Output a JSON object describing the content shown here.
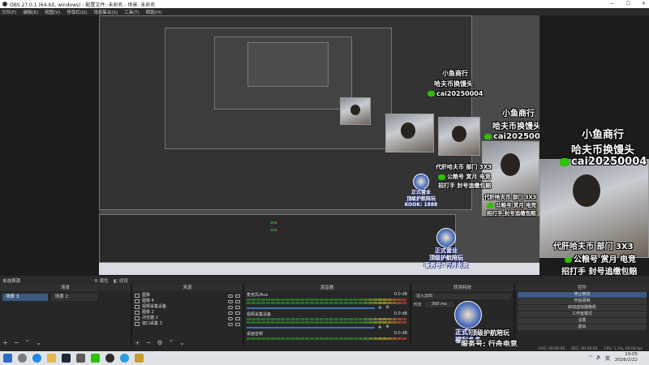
{
  "window": {
    "title": "OBS 27.0.1 (64-bit, windows) - 配置文件: 未命名 - 场景: 未命名",
    "controls": [
      "—",
      "☐",
      "✕"
    ]
  },
  "menu": [
    "文件(F)",
    "编辑(E)",
    "视图(V)",
    "停靠栏(D)",
    "场景集合(S)",
    "工具(T)",
    "帮助(H)"
  ],
  "overlay": {
    "line1": "小鱼商行",
    "line2": "哈夫币换馒头",
    "wechat_id": "cai20250004",
    "promo1": "代肝哈夫币 部门 3X3",
    "promo2": "公粮号 赏月 电竞",
    "promo3": "招打手 封号追缴包赔",
    "badge1": "正式营业",
    "badge2": "福利多多",
    "badge3": "顶级护航陪玩",
    "badge4": "服务号: 行舟电竞",
    "badge5": "KOOK: 1888"
  },
  "scene_bar": {
    "label": "未选择源",
    "properties": "属性",
    "filters": "滤镜"
  },
  "docks": {
    "scenes": {
      "title": "场景",
      "items": [
        "场景 3",
        "场景 2"
      ],
      "active": 0
    },
    "sources": {
      "title": "来源",
      "items": [
        "图像",
        "图像 4",
        "视频采集设备",
        "图像 2",
        "浏览器 2",
        "窗口采集 3"
      ]
    },
    "mixer": {
      "title": "混音器",
      "tracks": [
        {
          "name": "麦克风/Aux",
          "db": "0.0 dB"
        },
        {
          "name": "视频采集设备",
          "db": "0.0 dB"
        },
        {
          "name": "桌面音频",
          "db": "0.0 dB"
        }
      ]
    },
    "transitions": {
      "title": "转场特效",
      "type": "淡入淡出",
      "duration_label": "时长",
      "duration_value": "300 ms"
    },
    "controls": {
      "title": "控件",
      "buttons": [
        "停止推流",
        "开始录制",
        "启动虚拟摄像机",
        "工作室模式",
        "设置",
        "退出"
      ]
    }
  },
  "status": {
    "live": "LIVE: 00:00:00",
    "rec": "REC: 00:00:00",
    "cpu": "CPU: 1.1%, 60.00 fps"
  },
  "taskbar": {
    "time": "19:05",
    "date": "2026/2/22",
    "lang": "英"
  },
  "colors": {
    "accent": "#3d5a80",
    "wechat": "#2dc100",
    "meter_green": "#2d6b2d",
    "volume_blue": "#3b74c2"
  }
}
